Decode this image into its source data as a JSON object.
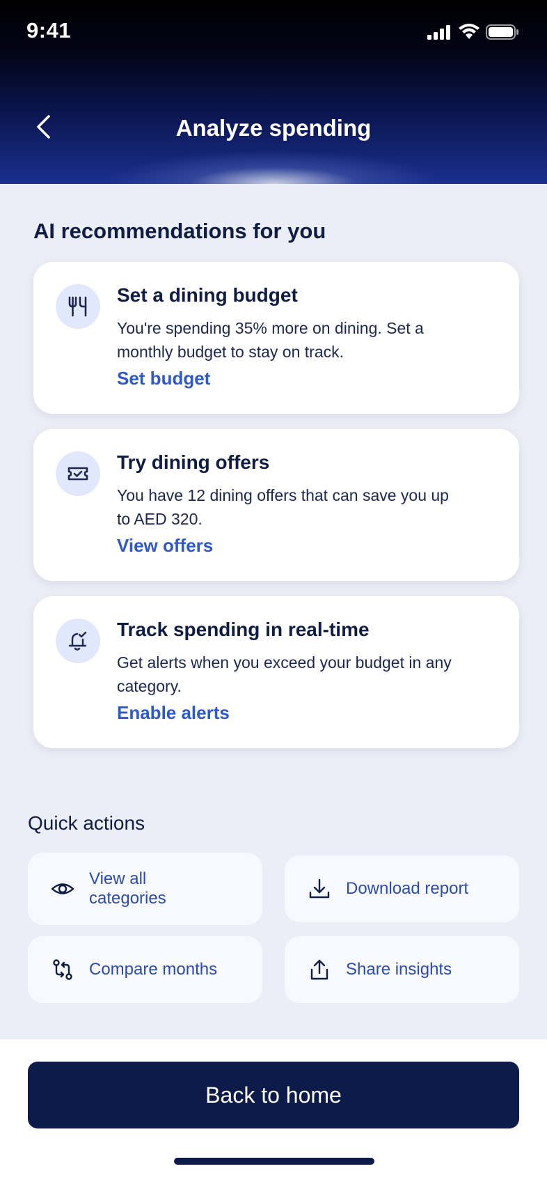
{
  "status_bar": {
    "time": "9:41"
  },
  "header": {
    "title": "Analyze spending"
  },
  "recommendations": {
    "title": "AI recommendations for you",
    "cards": [
      {
        "icon": "fork-knife-icon",
        "title": "Set a dining budget",
        "description": "You're spending 35% more on dining. Set a monthly budget to stay on track.",
        "link": "Set budget"
      },
      {
        "icon": "ticket-icon",
        "title": "Try dining offers",
        "description": "You have 12 dining offers that can save you up to AED 320.",
        "link": "View offers"
      },
      {
        "icon": "bell-check-icon",
        "title": "Track spending in real-time",
        "description": "Get alerts when you exceed your budget in any category.",
        "link": "Enable alerts"
      }
    ]
  },
  "quick_actions": {
    "title": "Quick actions",
    "items": [
      {
        "icon": "eye-icon",
        "label": "View all categories"
      },
      {
        "icon": "download-icon",
        "label": "Download report"
      },
      {
        "icon": "compare-icon",
        "label": "Compare months"
      },
      {
        "icon": "share-icon",
        "label": "Share insights"
      }
    ]
  },
  "footer": {
    "button_label": "Back to home"
  },
  "colors": {
    "primary": "#0d1b4b",
    "link": "#2f59c7",
    "background": "#ebeef6"
  }
}
